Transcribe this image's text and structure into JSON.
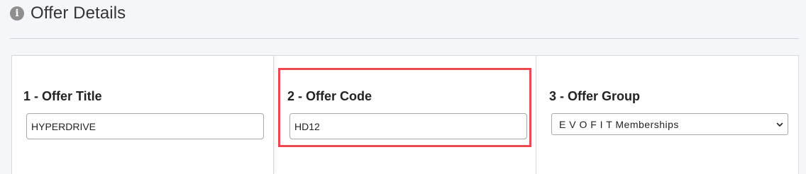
{
  "header": {
    "icon": "info-icon",
    "icon_glyph": "i",
    "title": "Offer Details"
  },
  "fields": {
    "offer_title": {
      "label": "1 - Offer Title",
      "value": "HYPERDRIVE"
    },
    "offer_code": {
      "label": "2 - Offer Code",
      "value": "HD12",
      "highlighted": true
    },
    "offer_group": {
      "label": "3 - Offer Group",
      "selected": "E V O F I T Memberships",
      "icon": "chevron-down-icon"
    }
  },
  "colors": {
    "highlight": "#ea4a4f",
    "background": "#f4f6fa",
    "panel": "#ffffff",
    "icon": "#8f8f8f"
  }
}
